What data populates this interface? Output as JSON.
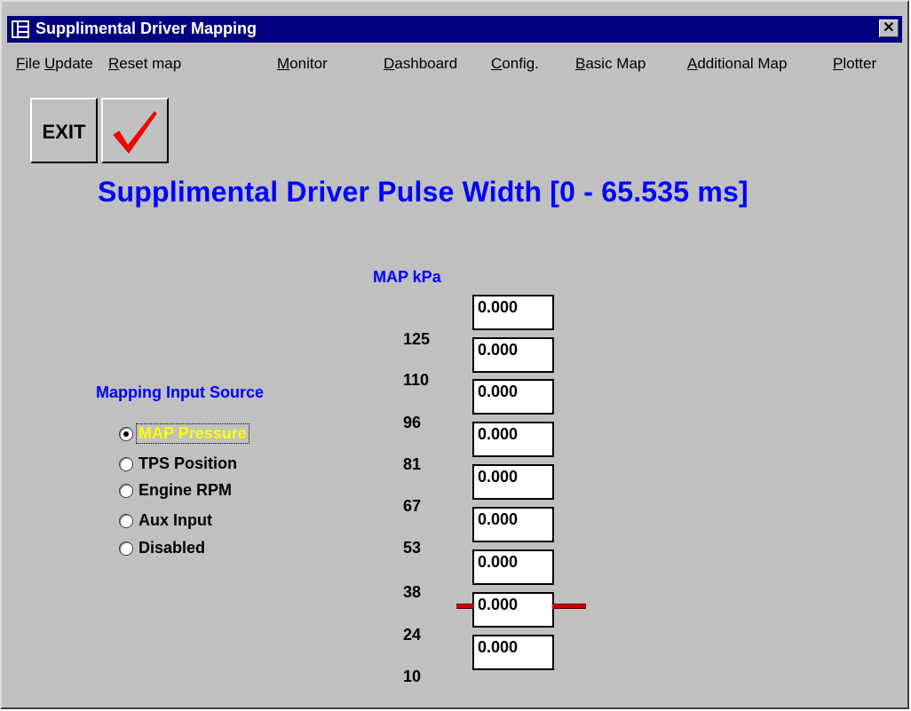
{
  "window": {
    "title": "Supplimental Driver Mapping",
    "close_glyph": "✕"
  },
  "menu": {
    "items": [
      {
        "label": "File",
        "underline": "F"
      },
      {
        "label": "Update",
        "underline": "U"
      },
      {
        "label": "Reset map",
        "underline": "R"
      },
      {
        "label": "Monitor",
        "underline": "M"
      },
      {
        "label": "Dashboard",
        "underline": "D"
      },
      {
        "label": "Config.",
        "underline": "C"
      },
      {
        "label": "Basic Map",
        "underline": "B"
      },
      {
        "label": "Additional Map",
        "underline": "A"
      },
      {
        "label": "Plotter",
        "underline": "P"
      }
    ]
  },
  "toolbar": {
    "exit_label": "EXIT",
    "ok_icon": "red-checkmark-icon"
  },
  "heading": "Supplimental Driver Pulse Width [0 - 65.535 ms]",
  "map": {
    "axis_title": "MAP kPa",
    "ticks": [
      "125",
      "110",
      "96",
      "81",
      "67",
      "53",
      "38",
      "24",
      "10"
    ],
    "cells": [
      "0.000",
      "0.000",
      "0.000",
      "0.000",
      "0.000",
      "0.000",
      "0.000",
      "0.000",
      "0.000"
    ],
    "marker_color": "#cc0000"
  },
  "input_source": {
    "title": "Mapping Input Source",
    "options": [
      {
        "label": "MAP Pressure",
        "selected": true
      },
      {
        "label": "TPS Position",
        "selected": false
      },
      {
        "label": "Engine RPM",
        "selected": false
      },
      {
        "label": "Aux Input",
        "selected": false
      },
      {
        "label": "Disabled",
        "selected": false
      }
    ]
  },
  "colors": {
    "titlebar": "#000080",
    "accent_text": "#0000ff",
    "selected_text": "#ffff00",
    "face": "#c0c0c0"
  }
}
